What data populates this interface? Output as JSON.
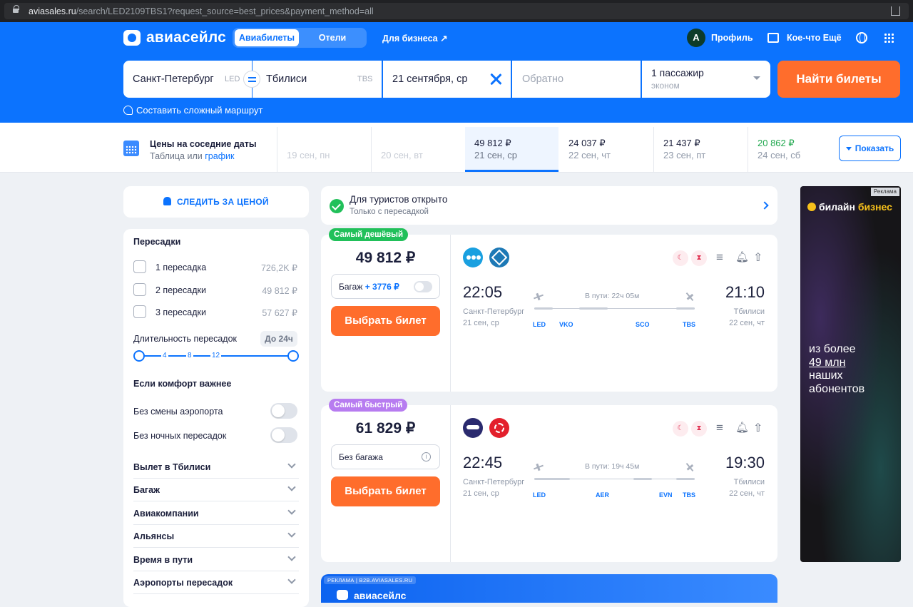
{
  "browser": {
    "url_host": "aviasales.ru",
    "url_path": "/search/LED2109TBS1?request_source=best_prices&payment_method=all"
  },
  "header": {
    "logo_text": "авиасейлс",
    "tabs": [
      {
        "label": "Авиабилеты"
      },
      {
        "label": "Отели"
      }
    ],
    "business_link": "Для бизнеса ↗",
    "avatar_letter": "A",
    "profile_label": "Профиль",
    "more_label": "Кое-что Ещё"
  },
  "search": {
    "origin": "Санкт-Петербург",
    "origin_code": "LED",
    "destination": "Тбилиси",
    "destination_code": "TBS",
    "depart_date": "21 сентября, ср",
    "return_placeholder": "Обратно",
    "passengers": "1 пассажир",
    "cabin_class": "эконом",
    "submit_label": "Найти билеты",
    "complex_route_link": "Составить сложный маршрут"
  },
  "nearby_dates": {
    "title": "Цены на соседние даты",
    "subtitle_prefix": "Таблица",
    "subtitle_or": " или ",
    "subtitle_link": "график",
    "cells": [
      {
        "price": "",
        "date": "19 сен, пн"
      },
      {
        "price": "",
        "date": "20 сен, вт"
      },
      {
        "price": "49 812 ₽",
        "date": "21 сен, ср"
      },
      {
        "price": "24 037 ₽",
        "date": "22 сен, чт"
      },
      {
        "price": "21 437 ₽",
        "date": "23 сен, пт"
      },
      {
        "price": "20 862 ₽",
        "date": "24 сен, сб"
      }
    ],
    "show_label": "Показать"
  },
  "sidebar": {
    "watch_price_label": "СЛЕДИТЬ ЗА ЦЕНОЙ",
    "transfers_title": "Пересадки",
    "transfers": [
      {
        "label": "1 пересадка",
        "price": "726,2K ₽"
      },
      {
        "label": "2 пересадки",
        "price": "49 812 ₽"
      },
      {
        "label": "3 пересадки",
        "price": "57 627 ₽"
      }
    ],
    "duration_title": "Длительность пересадок",
    "duration_badge": "До 24ч",
    "duration_ticks": [
      "4",
      "8",
      "12"
    ],
    "comfort_title": "Если комфорт важнее",
    "comfort_options": [
      {
        "label": "Без смены аэропорта"
      },
      {
        "label": "Без ночных пересадок"
      }
    ],
    "accordions": [
      {
        "label": "Вылет в Тбилиси"
      },
      {
        "label": "Багаж"
      },
      {
        "label": "Авиакомпании"
      },
      {
        "label": "Альянсы"
      },
      {
        "label": "Время в пути"
      },
      {
        "label": "Аэропорты пересадок"
      }
    ]
  },
  "notice": {
    "title": "Для туристов открыто",
    "subtitle": "Только с пересадкой"
  },
  "tickets": [
    {
      "badge": "Самый дешёвый",
      "badge_color": "#21c05a",
      "price": "49 812 ₽",
      "baggage_label": "Багаж",
      "baggage_extra": "+ 3776 ₽",
      "buy_label": "Выбрать билет",
      "depart_time": "22:05",
      "arrive_time": "21:10",
      "duration": "В пути: 22ч 05м",
      "depart_city": "Санкт-Петербург",
      "arrive_city": "Тбилиси",
      "depart_date": "21 сен, ср",
      "arrive_date": "22 сен, чт",
      "airports": [
        "LED",
        "VKO",
        "SCO",
        "TBS"
      ]
    },
    {
      "badge": "Самый быстрый",
      "badge_color": "#b77cf0",
      "price": "61 829 ₽",
      "baggage_label": "Без багажа",
      "baggage_extra": "",
      "buy_label": "Выбрать билет",
      "depart_time": "22:45",
      "arrive_time": "19:30",
      "duration": "В пути: 19ч 45м",
      "depart_city": "Санкт-Петербург",
      "arrive_city": "Тбилиси",
      "depart_date": "21 сен, ср",
      "arrive_date": "22 сен, чт",
      "airports": [
        "LED",
        "AER",
        "EVN",
        "TBS"
      ]
    }
  ],
  "promo": {
    "tag": "РЕКЛАМА | B2B.AVIASALES.RU",
    "logo_text": "авиасейлс"
  },
  "ad": {
    "label": "Реклама",
    "brand_a": "билайн",
    "brand_b": "бизнес",
    "lines": [
      "из более",
      "49 млн",
      "наших",
      "абонентов"
    ]
  },
  "colors": {
    "brand_blue": "#0c73fe",
    "accent_orange": "#ff6d2c",
    "cheap_green": "#21a84f"
  }
}
